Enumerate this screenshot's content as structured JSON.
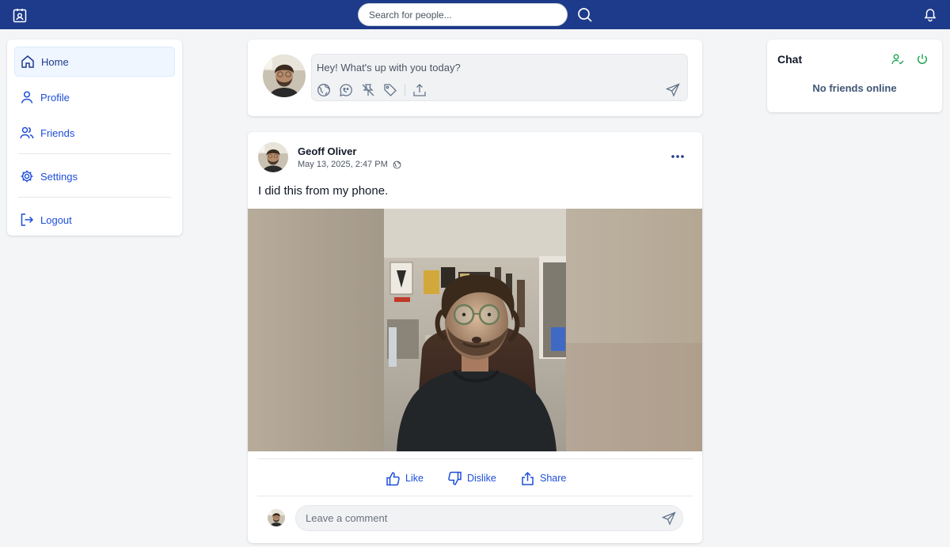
{
  "header": {
    "search": {
      "placeholder": "Search for people..."
    },
    "icons": {
      "logo": "contact-badge-icon",
      "search": "search-icon",
      "notifications": "bell-icon"
    }
  },
  "nav": {
    "items": [
      {
        "label": "Home",
        "icon": "home-icon",
        "active": true
      },
      {
        "label": "Profile",
        "icon": "user-icon"
      },
      {
        "label": "Friends",
        "icon": "users-icon"
      },
      {
        "label": "Settings",
        "icon": "gear-icon"
      },
      {
        "label": "Logout",
        "icon": "logout-icon"
      }
    ]
  },
  "composer": {
    "placeholder": "Hey! What's up with you today?",
    "tools": [
      "globe-icon",
      "speech-bubble-icon",
      "unpin-icon",
      "tag-icon",
      "upload-icon"
    ],
    "send_icon": "send-icon"
  },
  "post": {
    "author": "Geoff Oliver",
    "timestamp": "May 13, 2025, 2:47 PM",
    "visibility_icon": "globe-icon",
    "text": "I did this from my phone.",
    "actions": {
      "like": "Like",
      "dislike": "Dislike",
      "share": "Share"
    },
    "comment_placeholder": "Leave a comment"
  },
  "chat": {
    "title": "Chat",
    "empty_text": "No friends online",
    "icons": {
      "add": "add-friend-icon",
      "status": "power-icon"
    }
  },
  "colors": {
    "header_bg": "#1e3a8a",
    "accent": "#1d4ed8",
    "chat_online": "#16a34a",
    "page_bg": "#f4f5f7"
  }
}
